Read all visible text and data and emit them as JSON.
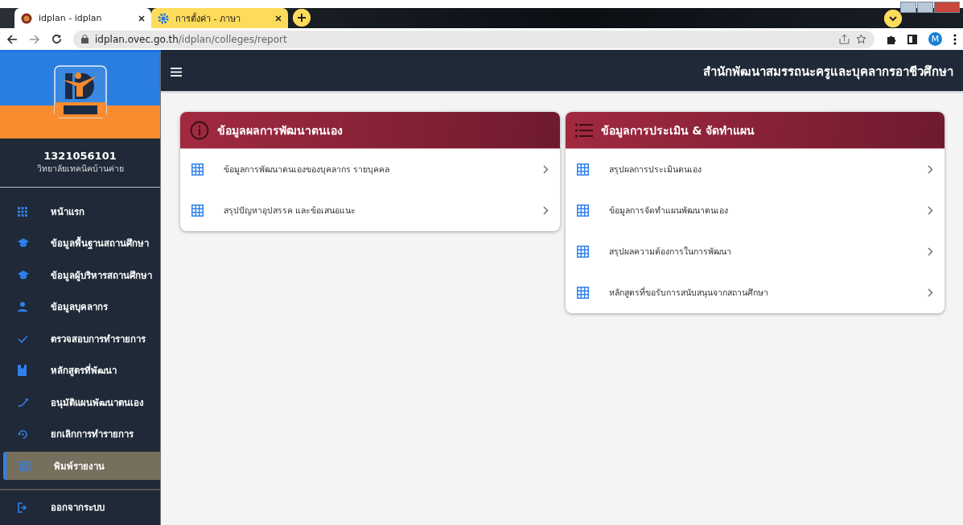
{
  "browser": {
    "tabs": [
      {
        "title": "idplan - idplan",
        "selected": true
      },
      {
        "title": "การตั้งค่า - ภาษา",
        "selected": false
      }
    ],
    "url": {
      "host": "idplan.ovec.go.th",
      "path": "/idplan/colleges/report"
    },
    "profile_initial": "M"
  },
  "sidebar": {
    "user": {
      "code": "1321056101",
      "school": "วิทยาลัยเทคนิคบ้านค่าย"
    },
    "items": [
      {
        "label": "หน้าแรก",
        "selected": false
      },
      {
        "label": "ข้อมูลพื้นฐานสถานศึกษา",
        "selected": false
      },
      {
        "label": "ข้อมูลผู้บริหารสถานศึกษา",
        "selected": false
      },
      {
        "label": "ข้อมูลบุคลากร",
        "selected": false
      },
      {
        "label": "ตรวจสอบการทำรายการ",
        "selected": false
      },
      {
        "label": "หลักสูตรที่พัฒนา",
        "selected": false
      },
      {
        "label": "อนุมัติแผนพัฒนาตนเอง",
        "selected": false
      },
      {
        "label": "ยกเลิกการทำรายการ",
        "selected": false
      },
      {
        "label": "พิมพ์รายงาน",
        "selected": true
      }
    ],
    "logout": {
      "label": "ออกจากระบบ"
    }
  },
  "header": {
    "title": "สำนักพัฒนาสมรรถนะครูและบุคลากรอาชีวศึกษา"
  },
  "cards": [
    {
      "title": "ข้อมูลผลการพัฒนาตนเอง",
      "items": [
        "ข้อมูลการพัฒนาตนเองของบุคลากร รายบุคคล",
        "สรุปปัญหาอุปสรรค และข้อเสนอแนะ"
      ]
    },
    {
      "title": "ข้อมูลการประเมิน & จัดทำแผน",
      "items": [
        "สรุปผลการประเมินตนเอง",
        "ข้อมูลการจัดทำแผนพัฒนาตนเอง",
        "สรุปผลความต้องการในการพัฒนา",
        "หลักสูตรที่ขอรับการสนับสนุนจากสถานศึกษา"
      ]
    }
  ]
}
